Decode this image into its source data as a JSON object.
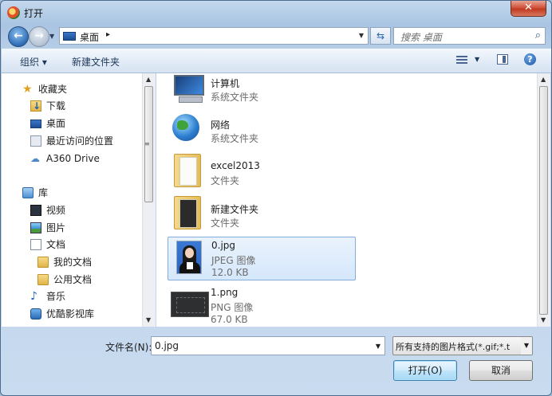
{
  "window": {
    "title": "打开",
    "close_glyph": "✕"
  },
  "address": {
    "location": "桌面",
    "chevron": "▸",
    "search_placeholder": "搜索 桌面"
  },
  "toolbar": {
    "organize": "组织 ▾",
    "new_folder": "新建文件夹",
    "help": "?"
  },
  "nav": {
    "favorites": [
      {
        "label": "收藏夹",
        "icon": "star-icon"
      },
      {
        "label": "下载",
        "icon": "download-folder-icon"
      },
      {
        "label": "桌面",
        "icon": "desktop-icon"
      },
      {
        "label": "最近访问的位置",
        "icon": "recent-places-icon"
      },
      {
        "label": "A360 Drive",
        "icon": "cloud-drive-icon"
      }
    ],
    "libraries": [
      {
        "label": "库",
        "icon": "library-icon"
      },
      {
        "label": "视频",
        "icon": "video-icon"
      },
      {
        "label": "图片",
        "icon": "picture-icon"
      },
      {
        "label": "文档",
        "icon": "document-icon"
      },
      {
        "label": "我的文档",
        "icon": "folder-icon"
      },
      {
        "label": "公用文档",
        "icon": "folder-icon"
      },
      {
        "label": "音乐",
        "icon": "music-icon"
      },
      {
        "label": "优酷影视库",
        "icon": "youku-icon"
      }
    ]
  },
  "files": [
    {
      "name": "计算机",
      "type": "系统文件夹",
      "size": "",
      "icon": "computer-icon"
    },
    {
      "name": "网络",
      "type": "系统文件夹",
      "size": "",
      "icon": "network-icon"
    },
    {
      "name": "excel2013",
      "type": "文件夹",
      "size": "",
      "icon": "folder-icon"
    },
    {
      "name": "新建文件夹",
      "type": "文件夹",
      "size": "",
      "icon": "folder-icon"
    },
    {
      "name": "0.jpg",
      "type": "JPEG 图像",
      "size": "12.0 KB",
      "icon": "jpg-thumbnail",
      "selected": true
    },
    {
      "name": "1.png",
      "type": "PNG 图像",
      "size": "67.0 KB",
      "icon": "png-thumbnail"
    }
  ],
  "footer": {
    "filename_label": "文件名(N):",
    "filename_value": "0.jpg",
    "filter_value": "所有支持的图片格式(*.gif;*.t",
    "open_button": "打开(O)",
    "cancel_button": "取消"
  }
}
